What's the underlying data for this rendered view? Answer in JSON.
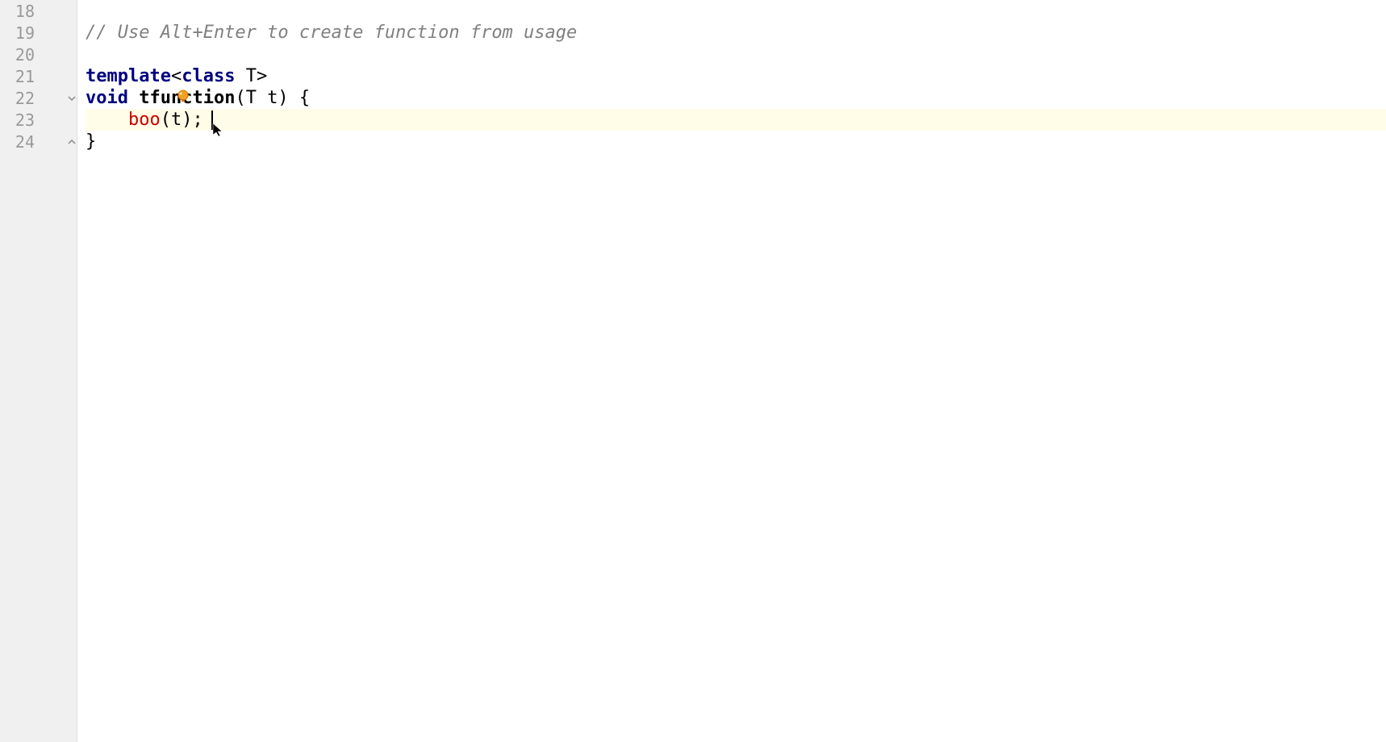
{
  "gutter": {
    "lines": [
      "18",
      "19",
      "20",
      "21",
      "22",
      "23",
      "24"
    ]
  },
  "code": {
    "line18": "",
    "line19_comment": "// Use Alt+Enter to create function from usage",
    "line20": "",
    "line21_template": "template",
    "line21_open": "<",
    "line21_class": "class",
    "line21_rest": " T>",
    "line22_void": "void",
    "line22_space1": " ",
    "line22_fname": "tfunction",
    "line22_rest": "(T t) {",
    "line23_indent": "    ",
    "line23_boo": "boo",
    "line23_rest": "(t);",
    "line24_close": "}"
  },
  "icons": {
    "intention_bulb": "intention-bulb-icon",
    "fold_open": "fold-open-marker",
    "fold_close": "fold-close-marker",
    "mouse_cursor": "cursor"
  },
  "highlighted_line": 23
}
